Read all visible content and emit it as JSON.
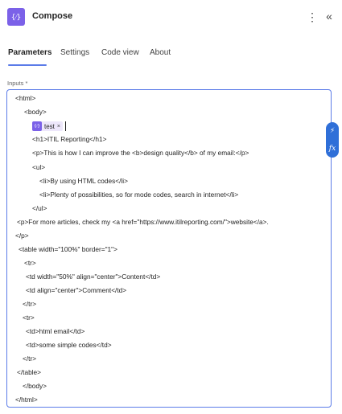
{
  "header": {
    "action_icon": "code-braces-icon",
    "action_icon_glyph": "{⁄}",
    "title": "Compose",
    "more_glyph": "⋮",
    "collapse_glyph": "«"
  },
  "tabs": [
    {
      "label": "Parameters",
      "active": true
    },
    {
      "label": "Settings",
      "active": false
    },
    {
      "label": "Code view",
      "active": false
    },
    {
      "label": "About",
      "active": false
    }
  ],
  "inputs_label": "Inputs *",
  "token": {
    "icon": "code-braces-icon",
    "icon_glyph": "{⁄}",
    "label": "test",
    "remove": "×"
  },
  "side_tools": {
    "dynamic_content_glyph": "⚡",
    "expression_glyph": "fx"
  },
  "code_lines": [
    "<html>",
    "<body>",
    "<h1>ITIL Reporting</h1>",
    "<p>This is how I can improve the <b>design quality</b> of my email:</p>",
    "<ul>",
    "<li>By using HTML codes</li>",
    "<li>Plenty of possibilities, so for mode codes, search in internet</li>",
    "</ul>",
    "<p>For more articles, check my <a href=\"https://www.itilreporting.com/\">website</a>.",
    "</p>",
    "<table width=\"100%\" border=\"1\">",
    "<tr>",
    "<td width=\"50%\" align=\"center\">Content</td>",
    "<td align=\"center\">Comment</td>",
    "</tr>",
    "<tr>",
    "<td>html email</td>",
    "<td>some simple codes</td>",
    "</tr>",
    "</table>",
    "</body>",
    "</html>"
  ],
  "colors": {
    "accent": "#5b7be8",
    "action_purple": "#7b61e8",
    "tool_blue": "#2f6fd8"
  }
}
